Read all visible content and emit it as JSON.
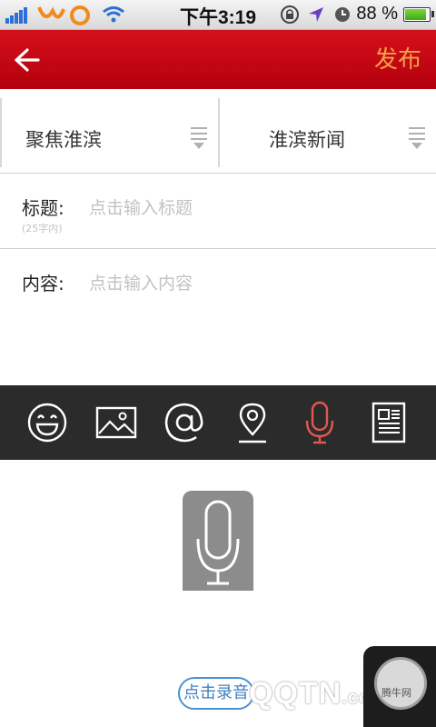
{
  "status_bar": {
    "time": "下午3:19",
    "battery_percent": "88 %",
    "battery_level": 0.88,
    "icons": [
      "signal-icon",
      "carrier-logo-icon",
      "wifi-icon",
      "rotation-lock-icon",
      "location-icon",
      "alarm-icon",
      "battery-icon"
    ]
  },
  "nav": {
    "back_icon": "back-arrow-icon",
    "publish_label": "发布",
    "colors": {
      "bar": "#c10512",
      "publish": "#f5a04a"
    }
  },
  "categories": [
    {
      "label": "聚焦淮滨",
      "icon": "dropdown-icon"
    },
    {
      "label": "淮滨新闻",
      "icon": "dropdown-icon"
    }
  ],
  "title_field": {
    "label": "标题:",
    "placeholder": "点击输入标题",
    "hint": "(25字内)"
  },
  "content_field": {
    "label": "内容:",
    "placeholder": "点击输入内容"
  },
  "toolbar": {
    "items": [
      "emoji-icon",
      "image-icon",
      "at-mention-icon",
      "location-pin-icon",
      "microphone-icon",
      "article-icon"
    ],
    "active": "microphone-icon",
    "active_color": "#e0584f"
  },
  "record": {
    "button_label": "点击录音",
    "mic_icon": "microphone-icon"
  },
  "watermark": {
    "logo": "QQTN",
    "logo_suffix": ".com",
    "small_text": "腾牛网"
  }
}
